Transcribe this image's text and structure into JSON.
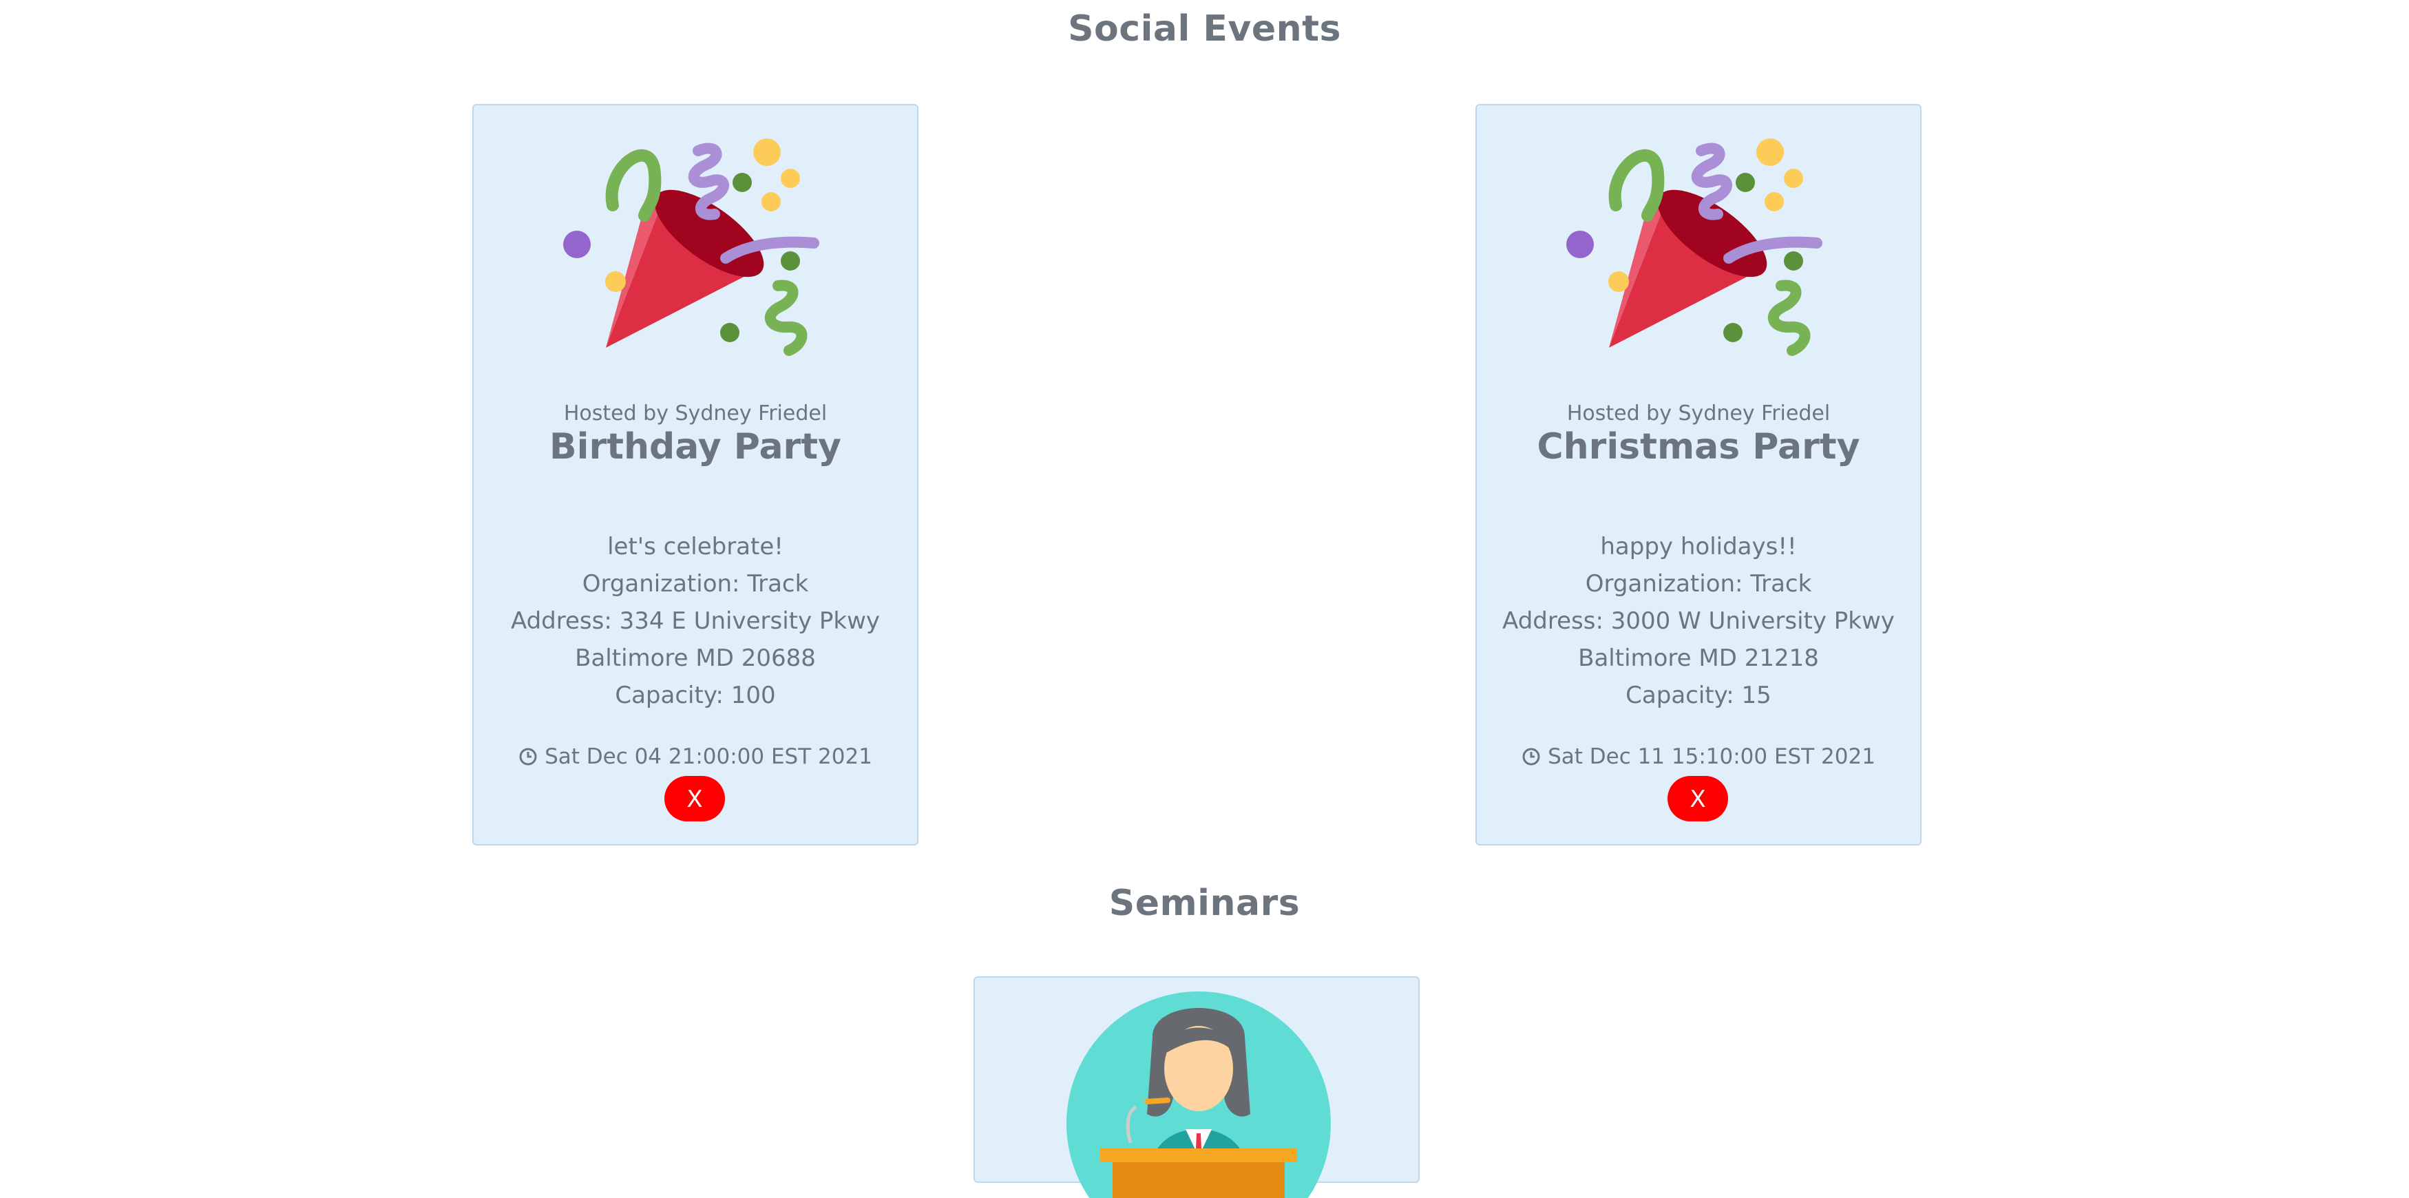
{
  "sections": {
    "social_title": "Social Events",
    "seminars_title": "Seminars"
  },
  "social_events": [
    {
      "host": "Hosted by Sydney Friedel",
      "title": "Birthday Party",
      "description": "let's celebrate!",
      "organization": "Organization: Track",
      "address_line1": "Address: 334 E University Pkwy",
      "address_line2": "Baltimore MD 20688",
      "capacity": "Capacity: 100",
      "datetime": "Sat Dec 04 21:00:00 EST 2021",
      "delete_label": "X",
      "icon": "party-popper-icon"
    },
    {
      "host": "Hosted by Sydney Friedel",
      "title": "Christmas Party",
      "description": "happy holidays!!",
      "organization": "Organization: Track",
      "address_line1": "Address: 3000 W University Pkwy",
      "address_line2": "Baltimore MD 21218",
      "capacity": "Capacity: 15",
      "datetime": "Sat Dec 11 15:10:00 EST 2021",
      "delete_label": "X",
      "icon": "party-popper-icon"
    }
  ],
  "seminars": [
    {
      "icon": "speaker-at-podium-icon"
    }
  ],
  "colors": {
    "card_bg": "#e1effb",
    "card_border": "#bcd7ee",
    "text": "#6c757d",
    "delete_button": "#ff0000"
  }
}
